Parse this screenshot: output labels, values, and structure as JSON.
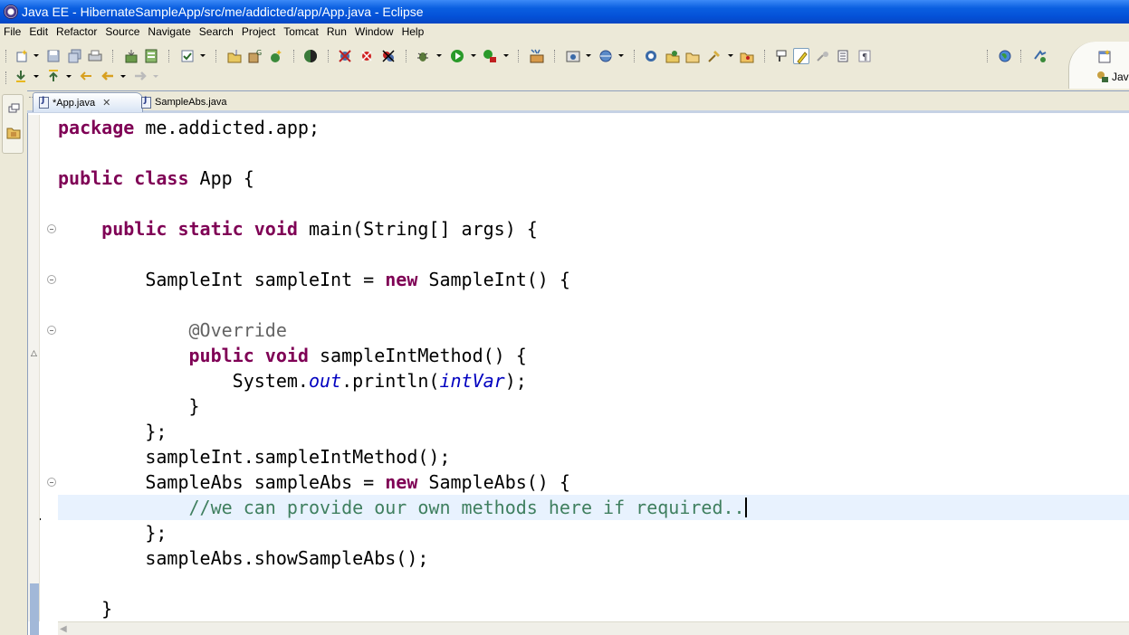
{
  "window": {
    "title": "Java EE - HibernateSampleApp/src/me/addicted/app/App.java - Eclipse"
  },
  "menubar": {
    "items": [
      "File",
      "Edit",
      "Refactor",
      "Source",
      "Navigate",
      "Search",
      "Project",
      "Tomcat",
      "Run",
      "Window",
      "Help"
    ]
  },
  "perspective": {
    "label": "Jav"
  },
  "editor": {
    "tabs": [
      {
        "label": "*App.java",
        "active": true,
        "dirty": true,
        "close_glyph": "✕"
      },
      {
        "label": "SampleAbs.java",
        "active": false
      }
    ],
    "code_lines": [
      {
        "segments": [
          {
            "t": "kw",
            "v": "package"
          },
          {
            "t": "plain",
            "v": " me.addicted.app;"
          }
        ]
      },
      {
        "segments": []
      },
      {
        "segments": [
          {
            "t": "kw",
            "v": "public"
          },
          {
            "t": "plain",
            "v": " "
          },
          {
            "t": "kw",
            "v": "class"
          },
          {
            "t": "plain",
            "v": " App {"
          }
        ]
      },
      {
        "segments": []
      },
      {
        "segments": [
          {
            "t": "plain",
            "v": "    "
          },
          {
            "t": "kw",
            "v": "public"
          },
          {
            "t": "plain",
            "v": " "
          },
          {
            "t": "kw",
            "v": "static"
          },
          {
            "t": "plain",
            "v": " "
          },
          {
            "t": "kw",
            "v": "void"
          },
          {
            "t": "plain",
            "v": " main(String[] args) {"
          }
        ],
        "fold": true
      },
      {
        "segments": []
      },
      {
        "segments": [
          {
            "t": "plain",
            "v": "        SampleInt sampleInt = "
          },
          {
            "t": "kw",
            "v": "new"
          },
          {
            "t": "plain",
            "v": " SampleInt() {"
          }
        ],
        "fold": true
      },
      {
        "segments": []
      },
      {
        "segments": [
          {
            "t": "ann",
            "v": "            @Override"
          }
        ],
        "fold": true
      },
      {
        "segments": [
          {
            "t": "plain",
            "v": "            "
          },
          {
            "t": "kw",
            "v": "public"
          },
          {
            "t": "plain",
            "v": " "
          },
          {
            "t": "kw",
            "v": "void"
          },
          {
            "t": "plain",
            "v": " sampleIntMethod() {"
          }
        ]
      },
      {
        "segments": [
          {
            "t": "plain",
            "v": "                System."
          },
          {
            "t": "field",
            "v": "out"
          },
          {
            "t": "plain",
            "v": ".println("
          },
          {
            "t": "field",
            "v": "intVar"
          },
          {
            "t": "plain",
            "v": ");"
          }
        ]
      },
      {
        "segments": [
          {
            "t": "plain",
            "v": "            }"
          }
        ]
      },
      {
        "segments": [
          {
            "t": "plain",
            "v": "        };"
          }
        ]
      },
      {
        "segments": [
          {
            "t": "plain",
            "v": "        sampleInt.sampleIntMethod();"
          }
        ]
      },
      {
        "segments": [
          {
            "t": "plain",
            "v": "        SampleAbs sampleAbs = "
          },
          {
            "t": "kw",
            "v": "new"
          },
          {
            "t": "plain",
            "v": " SampleAbs() {"
          }
        ],
        "fold": true
      },
      {
        "segments": [
          {
            "t": "plain",
            "v": "            "
          },
          {
            "t": "cmt",
            "v": "//we can provide our own methods here if required.."
          }
        ],
        "current": true,
        "cursor": true
      },
      {
        "segments": [
          {
            "t": "plain",
            "v": "        };"
          }
        ]
      },
      {
        "segments": [
          {
            "t": "plain",
            "v": "        sampleAbs.showSampleAbs();"
          }
        ]
      },
      {
        "segments": []
      },
      {
        "segments": [
          {
            "t": "plain",
            "v": "    }"
          }
        ]
      }
    ]
  },
  "toolbar_icons": [
    "new-wizard-icon",
    "save-icon",
    "save-all-icon",
    "print-icon",
    "deploy-icon",
    "build-icon",
    "task-icon",
    "new-java-project-icon",
    "new-package-icon",
    "new-class-icon",
    "eclipse-marketplace-icon",
    "skip-breakpoints-icon",
    "remove-breakpoint-icon",
    "remove-all-breakpoints-icon",
    "debug-icon",
    "run-icon",
    "external-tools-icon",
    "servers-icon",
    "new-server-icon",
    "web-service-icon",
    "open-type-icon",
    "open-task-icon",
    "open-folder-icon",
    "search-icon",
    "open-package-icon",
    "toggle-breadcrumb-icon",
    "toggle-mark-occurrences-icon",
    "highlight-icon",
    "block-selection-icon",
    "show-whitespace-icon",
    "globe-icon",
    "perspective-switch-icon"
  ],
  "colors": {
    "keyword": "#7f0055",
    "annotation": "#646464",
    "field": "#0000c0",
    "comment": "#3f7f5f",
    "current_line": "#e8f2fe"
  }
}
